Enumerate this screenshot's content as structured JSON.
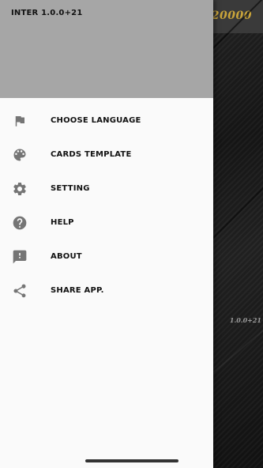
{
  "background_app": {
    "score": "20000",
    "version_watermark": "1.0.0+21"
  },
  "drawer": {
    "header_title": "INTER 1.0.0+21",
    "items": [
      {
        "label": "CHOOSE LANGUAGE",
        "icon": "flag-icon"
      },
      {
        "label": "CARDS TEMPLATE",
        "icon": "palette-icon"
      },
      {
        "label": "SETTING",
        "icon": "gear-icon"
      },
      {
        "label": "HELP",
        "icon": "help-circle-icon"
      },
      {
        "label": "ABOUT",
        "icon": "feedback-icon"
      },
      {
        "label": "SHARE APP.",
        "icon": "share-icon"
      }
    ]
  },
  "colors": {
    "drawer_header": "#a6a6a6",
    "drawer_body": "#fafafa",
    "icon": "#757575",
    "score_gold": "#caa53a"
  }
}
